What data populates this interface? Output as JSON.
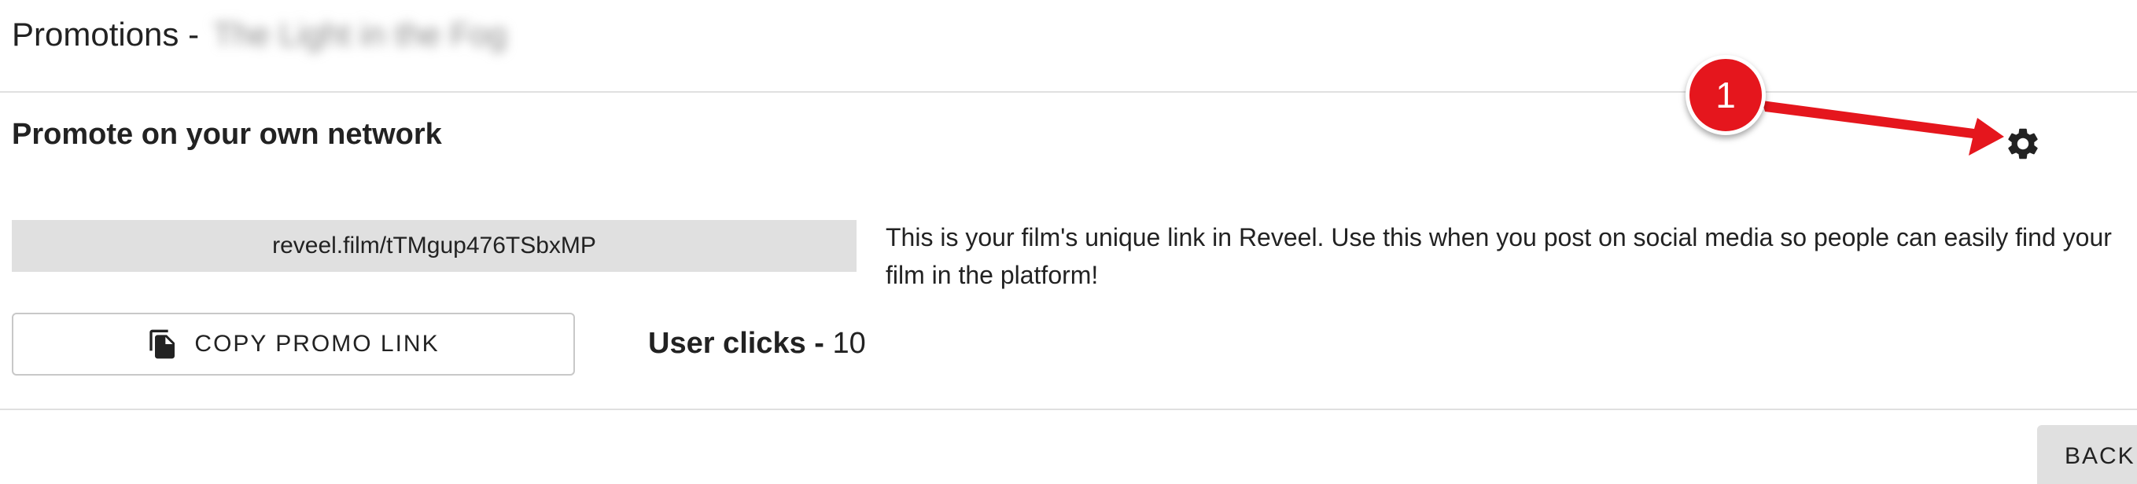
{
  "header": {
    "title_prefix": "Promotions -",
    "film_name": "The Light in the Fog"
  },
  "section": {
    "title": "Promote on your own network"
  },
  "promo": {
    "link": "reveel.film/tTMgup476TSbxMP",
    "description": "This is your film's unique link in Reveel. Use this when you post on social media so people can easily find your film in the platform!",
    "copy_button_label": "COPY PROMO LINK",
    "copy_icon": "copy-icon",
    "user_clicks_label": "User clicks -",
    "user_clicks_value": "10"
  },
  "settings": {
    "icon": "gear-icon"
  },
  "annotation": {
    "badge_number": "1",
    "color": "#e5161d"
  },
  "footer": {
    "back_label": "BACK"
  }
}
